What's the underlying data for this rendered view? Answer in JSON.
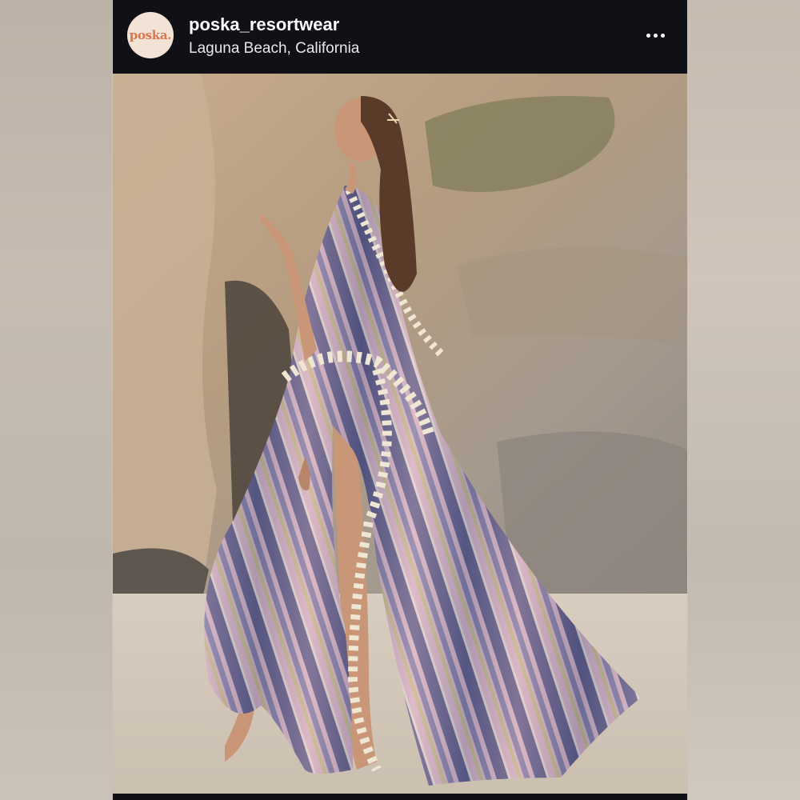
{
  "post": {
    "avatar_text": "poska.",
    "username": "poska_resortwear",
    "location": "Laguna Beach, California",
    "more_icon": "more-horizontal-icon"
  },
  "colors": {
    "header_bg": "#0f1116",
    "avatar_bg": "#f2e3d6",
    "avatar_text": "#d8754f",
    "kimono_pink": "#d9b6c4",
    "kimono_navy": "#4d4e79",
    "tassel_cream": "#efe6d3"
  }
}
